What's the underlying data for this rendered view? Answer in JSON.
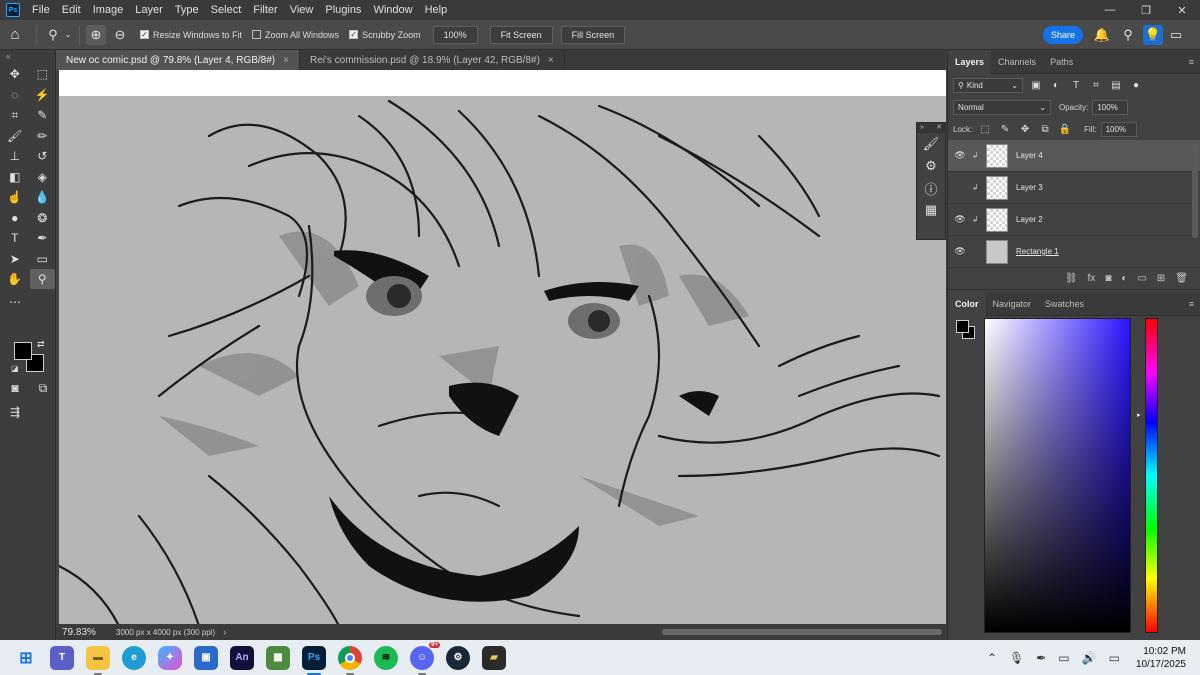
{
  "app": {
    "logo": "Ps",
    "menu": [
      "File",
      "Edit",
      "Image",
      "Layer",
      "Type",
      "Select",
      "Filter",
      "View",
      "Plugins",
      "Window",
      "Help"
    ],
    "window_controls": [
      "—",
      "❐",
      "✕"
    ]
  },
  "options": {
    "resize_windows": "Resize Windows to Fit",
    "zoom_all": "Zoom All Windows",
    "scrubby_zoom": "Scrubby Zoom",
    "zoom_value": "100%",
    "fit_screen": "Fit Screen",
    "fill_screen": "Fill Screen",
    "share": "Share",
    "checks": {
      "resize_windows": true,
      "zoom_all": false,
      "scrubby_zoom": true
    }
  },
  "tabs": [
    {
      "label": "New oc comic.psd @ 79.8% (Layer 4, RGB/8#)",
      "active": true
    },
    {
      "label": "Rei's commission.psd @ 18.9% (Layer 42, RGB/8#)",
      "active": false
    }
  ],
  "status": {
    "zoom": "79.83%",
    "doc_info": "3000 px x 4000 px (300 ppi)"
  },
  "panels": {
    "layers_tabs": [
      "Layers",
      "Channels",
      "Paths"
    ],
    "kind_label": "Kind",
    "blend_mode": "Normal",
    "opacity_label": "Opacity:",
    "opacity_value": "100%",
    "lock_label": "Lock:",
    "fill_label": "Fill:",
    "fill_value": "100%",
    "layers": [
      {
        "name": "Layer 4",
        "visible": true,
        "selected": true,
        "type": "pixel"
      },
      {
        "name": "Layer 3",
        "visible": false,
        "selected": false,
        "type": "pixel"
      },
      {
        "name": "Layer 2",
        "visible": true,
        "selected": false,
        "type": "pixel"
      },
      {
        "name": "Rectangle 1",
        "visible": true,
        "selected": false,
        "type": "shape"
      }
    ],
    "color_tabs": [
      "Color",
      "Navigator",
      "Swatches"
    ],
    "foreground_color": "#000000",
    "background_color": "#000000"
  },
  "taskbar": {
    "apps": [
      "windows-start",
      "teams",
      "file-explorer",
      "edge",
      "copilot",
      "microsoft-store",
      "animate",
      "minecraft",
      "photoshop",
      "chrome",
      "spotify",
      "discord",
      "steam",
      "app"
    ],
    "discord_badge": "9+",
    "time": "10:02 PM",
    "date": "10/17/2025"
  }
}
